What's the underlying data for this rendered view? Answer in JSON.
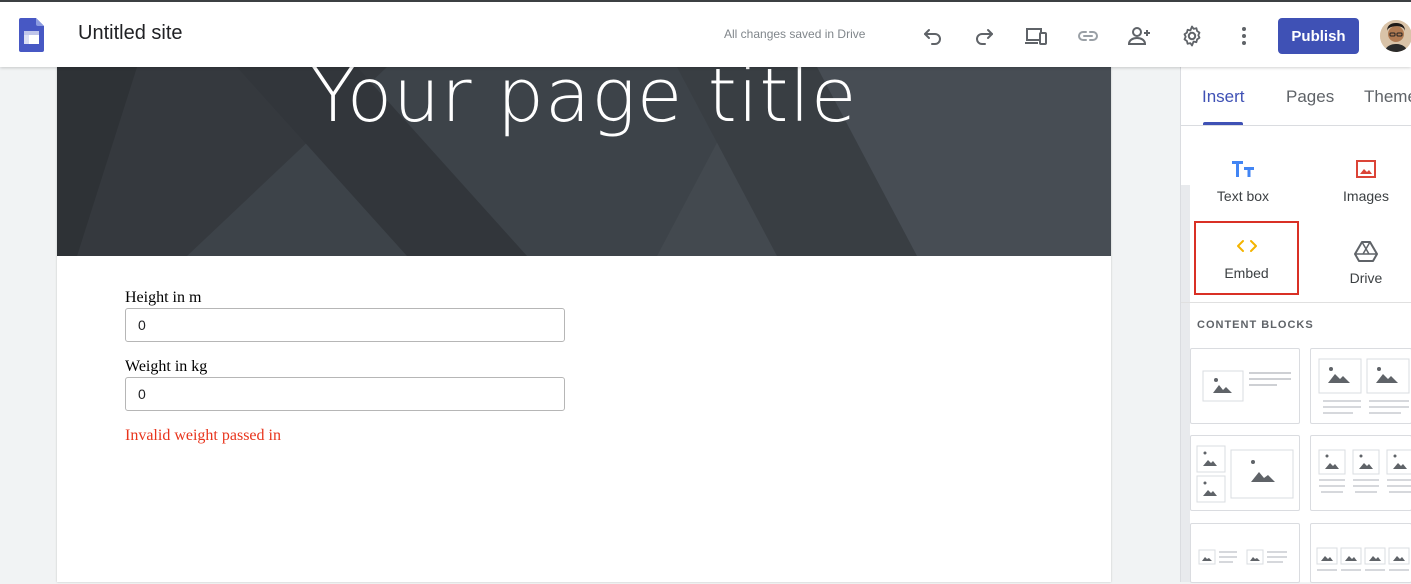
{
  "header": {
    "title": "Untitled site",
    "save_status": "All changes saved in Drive",
    "publish_label": "Publish",
    "icons": [
      "undo-icon",
      "redo-icon",
      "preview-icon",
      "link-icon",
      "share-icon",
      "settings-icon",
      "more-vert-icon"
    ]
  },
  "page": {
    "hero_title": "Your page title"
  },
  "form": {
    "height_label": "Height in m",
    "height_value": "0",
    "weight_label": "Weight in kg",
    "weight_value": "0",
    "error": "Invalid weight passed in"
  },
  "panel": {
    "tabs": [
      "Insert",
      "Pages",
      "Theme"
    ],
    "active_tab": "Insert",
    "insert_items": [
      {
        "label": "Text box",
        "icon": "text-box-icon"
      },
      {
        "label": "Images",
        "icon": "image-icon"
      },
      {
        "label": "Embed",
        "icon": "embed-icon",
        "highlighted": true
      },
      {
        "label": "Drive",
        "icon": "drive-icon"
      }
    ],
    "content_blocks_label": "CONTENT BLOCKS"
  },
  "colors": {
    "accent": "#3f51b5",
    "error": "#e8341c",
    "highlight_border": "#d93025",
    "embed_icon": "#f4b400",
    "image_icon": "#db4437",
    "text_icon": "#4285f4"
  }
}
